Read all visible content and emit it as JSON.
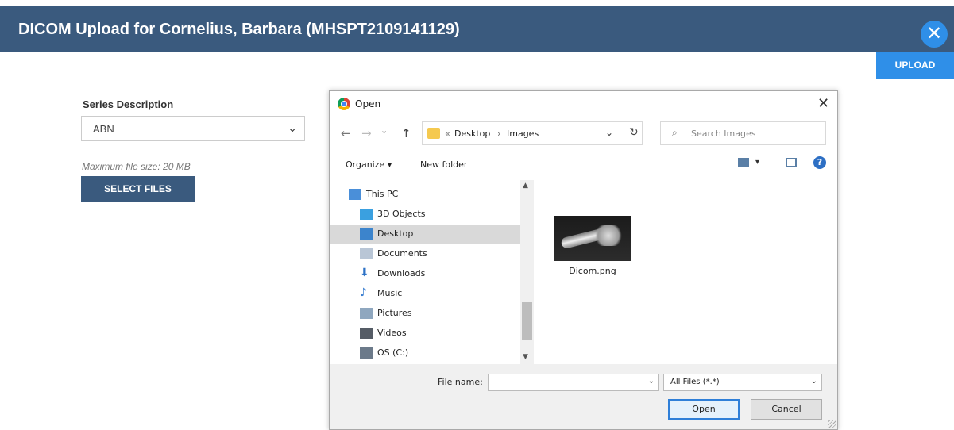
{
  "header": {
    "title": "DICOM Upload for Cornelius, Barbara (MHSPT2109141129)",
    "close_icon": "close-icon",
    "close_glyph": "✕",
    "colors": {
      "bar": "#3a5a7e",
      "accent": "#2f8fe8"
    }
  },
  "upload_button": {
    "label": "UPLOAD"
  },
  "form": {
    "series_label": "Series Description",
    "series_value": "ABN",
    "max_size_text": "Maximum file size: 20 MB",
    "select_files_label": "SELECT FILES"
  },
  "dialog": {
    "title": "Open",
    "close_glyph": "✕",
    "nav": {
      "back": "←",
      "forward": "→",
      "recent": "⌄",
      "up": "↑"
    },
    "address": {
      "prefix": "«",
      "segments": [
        "Desktop",
        "Images"
      ],
      "separator": "›"
    },
    "search_placeholder": "Search Images",
    "toolbar": {
      "organize": "Organize ▾",
      "new_folder": "New folder",
      "help": "?"
    },
    "tree": [
      {
        "label": "This PC",
        "icon": "computer-icon",
        "color": "#4a8fd9",
        "selected": false
      },
      {
        "label": "3D Objects",
        "icon": "cube-icon",
        "color": "#3aa0e0",
        "selected": false
      },
      {
        "label": "Desktop",
        "icon": "desktop-icon",
        "color": "#3c84cc",
        "selected": true
      },
      {
        "label": "Documents",
        "icon": "document-icon",
        "color": "#b9c6d6",
        "selected": false
      },
      {
        "label": "Downloads",
        "icon": "download-icon",
        "color": "#2d72c6",
        "selected": false
      },
      {
        "label": "Music",
        "icon": "music-icon",
        "color": "#3a7ed0",
        "selected": false
      },
      {
        "label": "Pictures",
        "icon": "pictures-icon",
        "color": "#8fa7bf",
        "selected": false
      },
      {
        "label": "Videos",
        "icon": "video-icon",
        "color": "#555c66",
        "selected": false
      },
      {
        "label": "OS (C:)",
        "icon": "drive-icon",
        "color": "#6c7a8a",
        "selected": false
      }
    ],
    "file": {
      "name": "Dicom.png"
    },
    "footer": {
      "file_name_label": "File name:",
      "file_name_value": "",
      "filter": "All Files (*.*)",
      "open_label": "Open",
      "cancel_label": "Cancel"
    }
  }
}
